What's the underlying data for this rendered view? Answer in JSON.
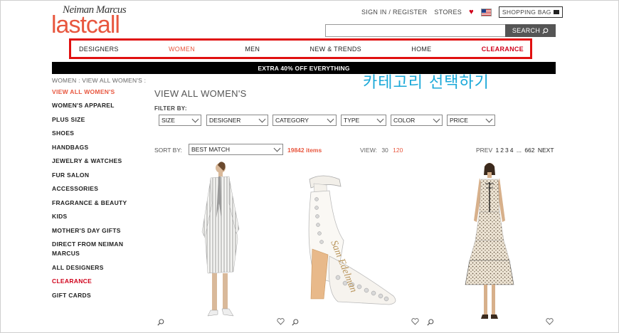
{
  "logo": {
    "top": "Neiman Marcus",
    "main": "lastcall"
  },
  "header": {
    "sign_in": "SIGN IN / REGISTER",
    "stores": "STORES",
    "bag": "SHOPPING BAG"
  },
  "search": {
    "button": "SEARCH"
  },
  "nav": [
    "DESIGNERS",
    "WOMEN",
    "MEN",
    "NEW & TRENDS",
    "HOME",
    "CLEARANCE"
  ],
  "promo": "EXTRA 40% OFF EVERYTHING",
  "annotation": "카테고리 선택하기",
  "breadcrumb": "WOMEN : VIEW ALL WOMEN'S :",
  "sidebar": [
    "VIEW ALL WOMEN'S",
    "WOMEN'S APPAREL",
    "PLUS SIZE",
    "SHOES",
    "HANDBAGS",
    "JEWELRY & WATCHES",
    "FUR SALON",
    "ACCESSORIES",
    "FRAGRANCE & BEAUTY",
    "KIDS",
    "MOTHER'S DAY GIFTS",
    "DIRECT FROM NEIMAN MARCUS",
    "ALL DESIGNERS",
    "CLEARANCE",
    "GIFT CARDS"
  ],
  "main": {
    "title": "VIEW ALL WOMEN'S",
    "filter_by": "FILTER BY:",
    "filters": [
      "SIZE",
      "DESIGNER",
      "CATEGORY",
      "TYPE",
      "COLOR",
      "PRICE"
    ],
    "sort_by": "SORT BY:",
    "sort_value": "BEST MATCH",
    "items_count": "19842 items",
    "view_label": "VIEW:",
    "view_options": [
      "30",
      "120"
    ],
    "pager": {
      "prev": "PREV",
      "pages": [
        "1",
        "2",
        "3",
        "4"
      ],
      "ellipsis": "...",
      "last": "662",
      "next": "NEXT"
    }
  },
  "colors": {
    "accent": "#e8573f",
    "clearance": "#d0021b",
    "highlight_box": "#e01010",
    "annotation": "#1aa8d8"
  }
}
